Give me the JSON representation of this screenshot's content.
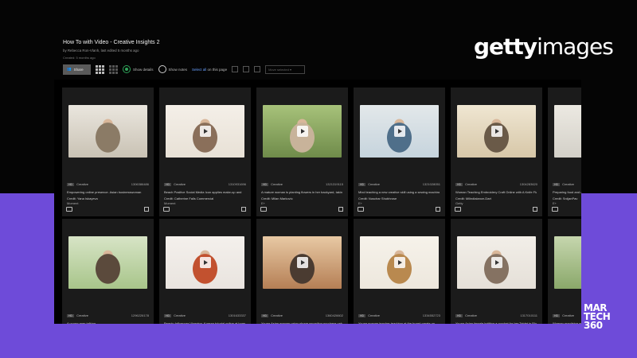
{
  "board": {
    "title": "How To with Video - Creative Insights 2",
    "meta": "by Rebecca Ron-Vlanh, last edited 5 months ago",
    "created": "Created: 5 months ago"
  },
  "toolbar": {
    "share_label": "Share",
    "show_details_label": "Show details",
    "show_notes_label": "Show notes",
    "select_all_label": "Select all",
    "on_this_page": " on this page",
    "move_placeholder": "Move selected ▾"
  },
  "logo": {
    "bold": "getty",
    "light": "images"
  },
  "watermark": {
    "line1": "MAR",
    "line2": "TECH",
    "line3": "360"
  },
  "cards_top": [
    {
      "type": "Creative",
      "id": "1306386486",
      "desc": "Empowering online presence. Asian businesswoman",
      "credit": "Credit: Yana Iskayeva",
      "src": "Moment",
      "colors": [
        "#c9c2b4",
        "#8b7b66",
        "#eae6de"
      ]
    },
    {
      "type": "Creative",
      "id": "1310931696",
      "desc": "Beach Positive Social Media Icon applies make-up and",
      "credit": "Credit: Catherine Falls Commercial",
      "src": "Moment",
      "colors": [
        "#e8e1d6",
        "#8a6f5a",
        "#f4efe8"
      ]
    },
    {
      "type": "Creative",
      "id": "1321319115",
      "desc": "A mature woman is planting flowers in her backyard, taking",
      "credit": "Credit: Milan Markovic",
      "src": "E+",
      "colors": [
        "#6f8b4a",
        "#c8b39a",
        "#a7c27a"
      ]
    },
    {
      "type": "Creative",
      "id": "1321028051",
      "desc": "Mixd teaching a new creative skill using a sewing machine",
      "credit": "Credit: Nuschar Shubhrose",
      "src": "E+",
      "colors": [
        "#c6d4dd",
        "#4f6f8a",
        "#e3e8ea"
      ]
    },
    {
      "type": "Creative",
      "id": "1304283620",
      "desc": "Woman Teaching Embroidery Craft Online with A Knife Flat",
      "credit": "Credit: Milindialance-Dart",
      "src": "Getty",
      "colors": [
        "#d7c7a8",
        "#6a5a48",
        "#efe6d2"
      ]
    },
    {
      "type": "Creative",
      "id": "1304",
      "desc": "Preparing food and ab",
      "credit": "Credit: SrdjanPav",
      "src": "E+",
      "colors": [
        "#d3d0c8",
        "#5b5a55",
        "#ece9e2"
      ]
    }
  ],
  "cards_bottom": [
    {
      "type": "Creative",
      "id": "1296226178",
      "desc": "A young man talking",
      "credit": "",
      "src": "",
      "colors": [
        "#a8c58a",
        "#5b4a3c",
        "#d7e4c6"
      ]
    },
    {
      "type": "Creative",
      "id": "1301633337",
      "desc": "Beauty Influencer Vlogging, Korean tutorial online at home",
      "credit": "",
      "src": "",
      "colors": [
        "#e9e4df",
        "#c2512f",
        "#f4f0ec"
      ]
    },
    {
      "type": "Creative",
      "id": "1360426602",
      "desc": "Young Asian woman using phone recording purchase order",
      "credit": "",
      "src": "",
      "colors": [
        "#b57f55",
        "#4a3b31",
        "#e8c9a4"
      ]
    },
    {
      "type": "Creative",
      "id": "1334552723",
      "desc": "Young woman teacher teaching at the board create on",
      "credit": "",
      "src": "",
      "colors": [
        "#ede7dd",
        "#b9894f",
        "#f6f2ea"
      ]
    },
    {
      "type": "Creative",
      "id": "1317010111",
      "desc": "Young Asian female knitting a crochet for her Tablet in Blog",
      "credit": "",
      "src": "",
      "colors": [
        "#e5e0d8",
        "#857262",
        "#f2eee8"
      ]
    },
    {
      "type": "Creative",
      "id": "1308",
      "desc": "Woman practising and",
      "credit": "",
      "src": "",
      "colors": [
        "#8aa86a",
        "#5d6e49",
        "#c6d6ae"
      ]
    }
  ]
}
